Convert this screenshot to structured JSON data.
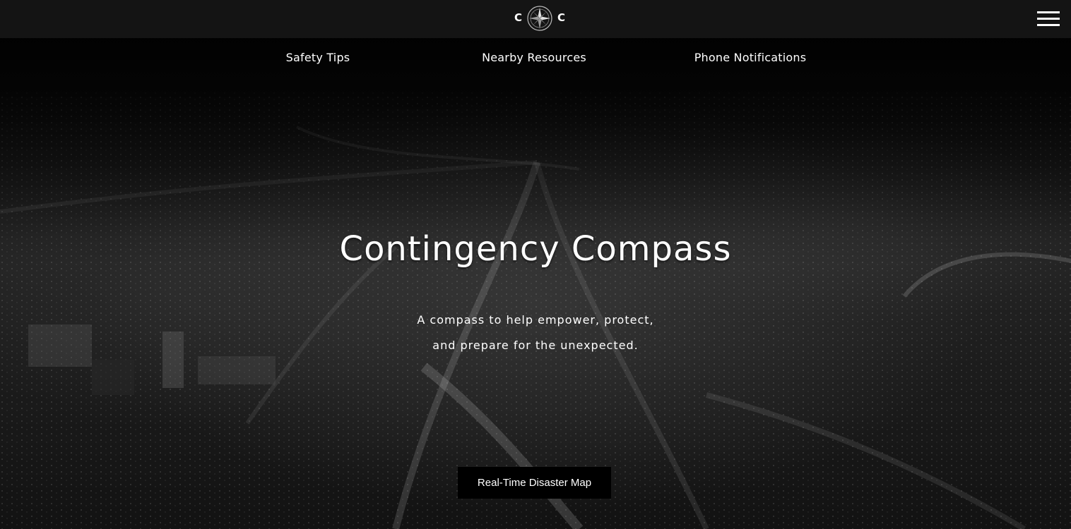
{
  "header": {
    "logo": {
      "left_letter": "C",
      "right_letter": "C",
      "icon": "compass-rose-icon"
    },
    "menu_icon": "hamburger-menu-icon"
  },
  "nav": {
    "items": [
      {
        "label": "Safety Tips"
      },
      {
        "label": "Nearby Resources"
      },
      {
        "label": "Phone Notifications"
      }
    ]
  },
  "hero": {
    "title": "Contingency Compass",
    "subtitle_line1": "A compass to help empower, protect,",
    "subtitle_line2": "and prepare for the unexpected.",
    "cta_label": "Real-Time Disaster Map",
    "background": "night-city-aerial-image"
  },
  "colors": {
    "topbar": "#141414",
    "text": "#ffffff",
    "button": "#000000"
  }
}
